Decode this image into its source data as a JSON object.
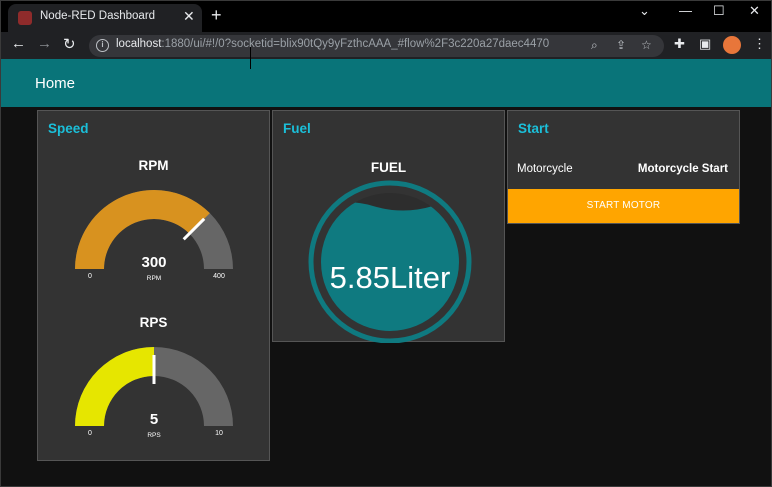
{
  "browser": {
    "tab_title": "Node-RED Dashboard",
    "url_host": "localhost",
    "url_rest": ":1880/ui/#!/0?socketid=blix90tQy9yFzthcAAA_#flow%2F3c220a27daec4470"
  },
  "dashboard": {
    "title": "Home"
  },
  "speed_group": {
    "title": "Speed",
    "rpm_gauge": {
      "title": "RPM",
      "value": "300",
      "units": "RPM",
      "min": "0",
      "max": "400",
      "fraction": 0.75,
      "color": "#d8921f"
    },
    "rps_gauge": {
      "title": "RPS",
      "value": "5",
      "units": "RPS",
      "min": "0",
      "max": "10",
      "fraction": 0.5,
      "color": "#e6e600"
    }
  },
  "fuel_group": {
    "title": "Fuel",
    "level_title": "FUEL",
    "level_text": "5.85Liter",
    "color": "#0f7a80"
  },
  "start_group": {
    "title": "Start",
    "row_label": "Motorcycle",
    "row_value": "Motorcycle Start",
    "button_label": "START MOTOR",
    "button_color": "#ffa500"
  }
}
